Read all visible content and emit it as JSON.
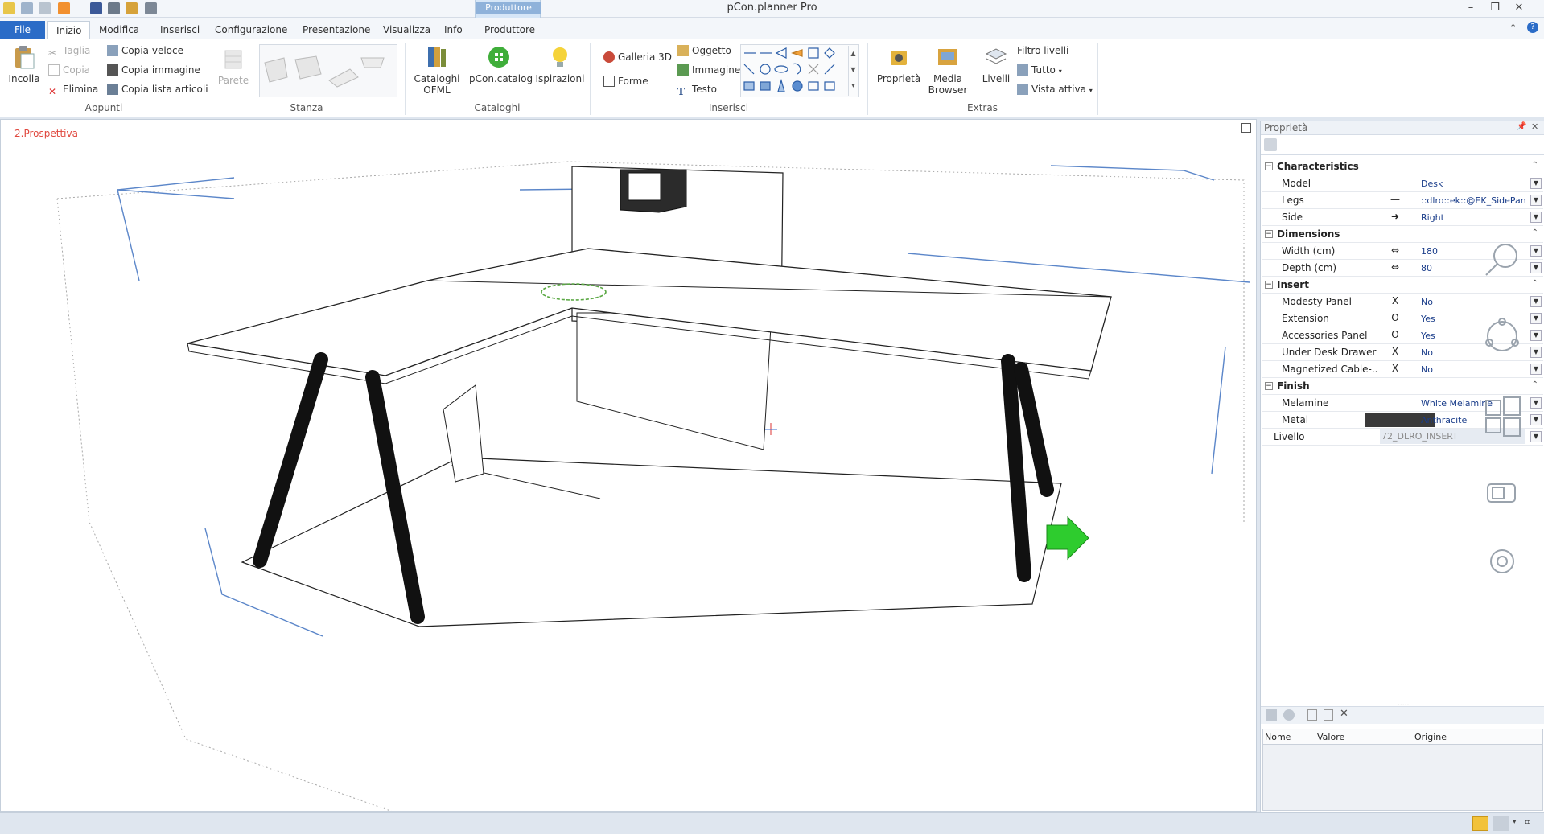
{
  "app": {
    "title": "pCon.planner Pro"
  },
  "tabs": {
    "file": "File",
    "items": [
      "Inizio",
      "Modifica",
      "Inserisci",
      "Configurazione",
      "Presentazione",
      "Visualizza",
      "Info",
      "Produttore"
    ],
    "active": "Inizio",
    "context_group": "Produttore"
  },
  "ribbon": {
    "appunti": {
      "label": "Appunti",
      "paste": "Incolla",
      "cut": "Taglia",
      "copy": "Copia",
      "delete": "Elimina",
      "quick_copy": "Copia veloce",
      "copy_image": "Copia immagine",
      "copy_articles": "Copia lista articoli"
    },
    "stanza": {
      "label": "Stanza",
      "wall": "Parete"
    },
    "cataloghi": {
      "label": "Cataloghi",
      "ofml": "Cataloghi OFML",
      "pcon_catalog": "pCon.catalog",
      "ideas": "Ispirazioni"
    },
    "inserisci": {
      "label": "Inserisci",
      "gallery": "Galleria 3D",
      "shapes": "Forme",
      "object": "Oggetto",
      "image": "Immagine",
      "text": "Testo"
    },
    "extras": {
      "label": "Extras",
      "properties": "Proprietà",
      "media_browser": "Media Browser",
      "layers": "Livelli",
      "layer_filter": "Filtro livelli",
      "all": "Tutto",
      "active_view": "Vista attiva"
    }
  },
  "viewport": {
    "label": "2.Prospettiva"
  },
  "properties": {
    "title": "Proprietà",
    "categories": [
      {
        "name": "Characteristics",
        "rows": [
          {
            "name": "Model",
            "sym": "—",
            "value": "Desk"
          },
          {
            "name": "Legs",
            "sym": "—",
            "value": "::dlro::ek::@EK_SidePan..."
          },
          {
            "name": "Side",
            "sym": "➜",
            "value": "Right"
          }
        ]
      },
      {
        "name": "Dimensions",
        "rows": [
          {
            "name": "Width (cm)",
            "sym": "⇔",
            "value": "180"
          },
          {
            "name": "Depth (cm)",
            "sym": "⇔",
            "value": "80"
          }
        ]
      },
      {
        "name": "Insert",
        "rows": [
          {
            "name": "Modesty Panel",
            "sym": "X",
            "value": "No"
          },
          {
            "name": "Extension",
            "sym": "O",
            "value": "Yes"
          },
          {
            "name": "Accessories Panel",
            "sym": "O",
            "value": "Yes"
          },
          {
            "name": "Under Desk Drawer",
            "sym": "X",
            "value": "No"
          },
          {
            "name": "Magnetized Cable-...",
            "sym": "X",
            "value": "No"
          }
        ]
      },
      {
        "name": "Finish",
        "rows": [
          {
            "name": "Melamine",
            "sym": "",
            "value": "White Melamine"
          },
          {
            "name": "Metal",
            "sym": "",
            "value": "Anthracite",
            "swatch": "#3a3a3a"
          }
        ]
      }
    ],
    "level": {
      "name": "Livello",
      "value": "72_DLRO_INSERT"
    },
    "grid_headers": [
      "Nome",
      "Valore",
      "Origine"
    ]
  },
  "colors": {
    "accent": "#2b6cc7",
    "guide_lines": "#5b86c9",
    "leg": "#1e1e1e",
    "arrow": "#2ecc2e"
  }
}
